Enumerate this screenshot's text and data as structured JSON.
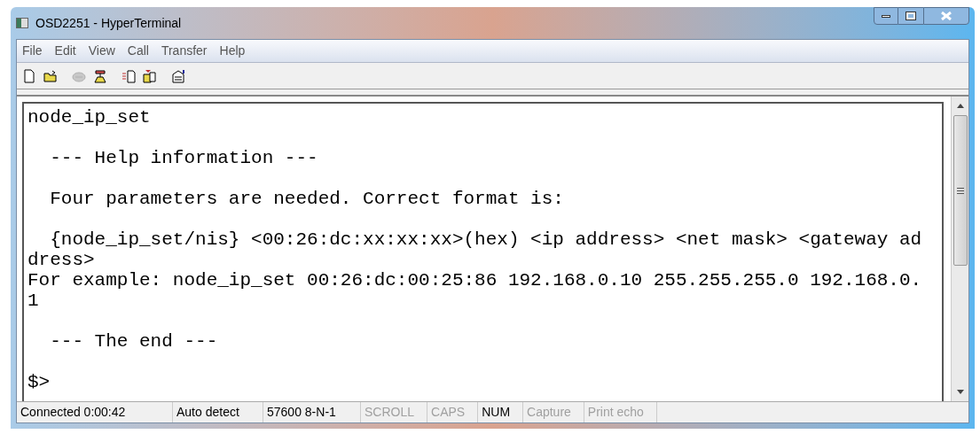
{
  "window": {
    "title": "OSD2251 - HyperTerminal"
  },
  "menu": [
    "File",
    "Edit",
    "View",
    "Call",
    "Transfer",
    "Help"
  ],
  "toolbar": [
    {
      "kind": "new",
      "disabled": false
    },
    {
      "kind": "open",
      "disabled": false
    },
    {
      "kind": "phone",
      "disabled": true
    },
    {
      "kind": "dial",
      "disabled": false
    },
    {
      "kind": "send",
      "disabled": false
    },
    {
      "kind": "receive",
      "disabled": false
    },
    {
      "kind": "properties",
      "disabled": false
    }
  ],
  "terminal": {
    "lines": [
      {
        "kind": "text",
        "text": "node_ip_set"
      },
      {
        "kind": "blank"
      },
      {
        "kind": "text",
        "text": "  --- Help information ---"
      },
      {
        "kind": "blank"
      },
      {
        "kind": "text",
        "text": "  Four parameters are needed. Correct format is:"
      },
      {
        "kind": "blank"
      },
      {
        "kind": "text",
        "text": "  {node_ip_set/nis} <00:26:dc:xx:xx:xx>(hex) <ip address> <net mask> <gateway ad"
      },
      {
        "kind": "text",
        "text": "dress>"
      },
      {
        "kind": "text",
        "text": "For example: node_ip_set 00:26:dc:00:25:86 192.168.0.10 255.255.255.0 192.168.0."
      },
      {
        "kind": "text",
        "text": "1"
      },
      {
        "kind": "blank"
      },
      {
        "kind": "text",
        "text": "  --- The end ---"
      },
      {
        "kind": "blank"
      },
      {
        "kind": "text",
        "text": "$>"
      }
    ]
  },
  "status_bar": [
    {
      "text": "Connected 0:00:42",
      "disabled": false
    },
    {
      "text": "Auto detect",
      "disabled": false
    },
    {
      "text": "57600 8-N-1",
      "disabled": false
    },
    {
      "text": "SCROLL",
      "disabled": true
    },
    {
      "text": "CAPS",
      "disabled": true
    },
    {
      "text": "NUM",
      "disabled": false
    },
    {
      "text": "Capture",
      "disabled": true
    },
    {
      "text": "Print echo",
      "disabled": true
    }
  ]
}
